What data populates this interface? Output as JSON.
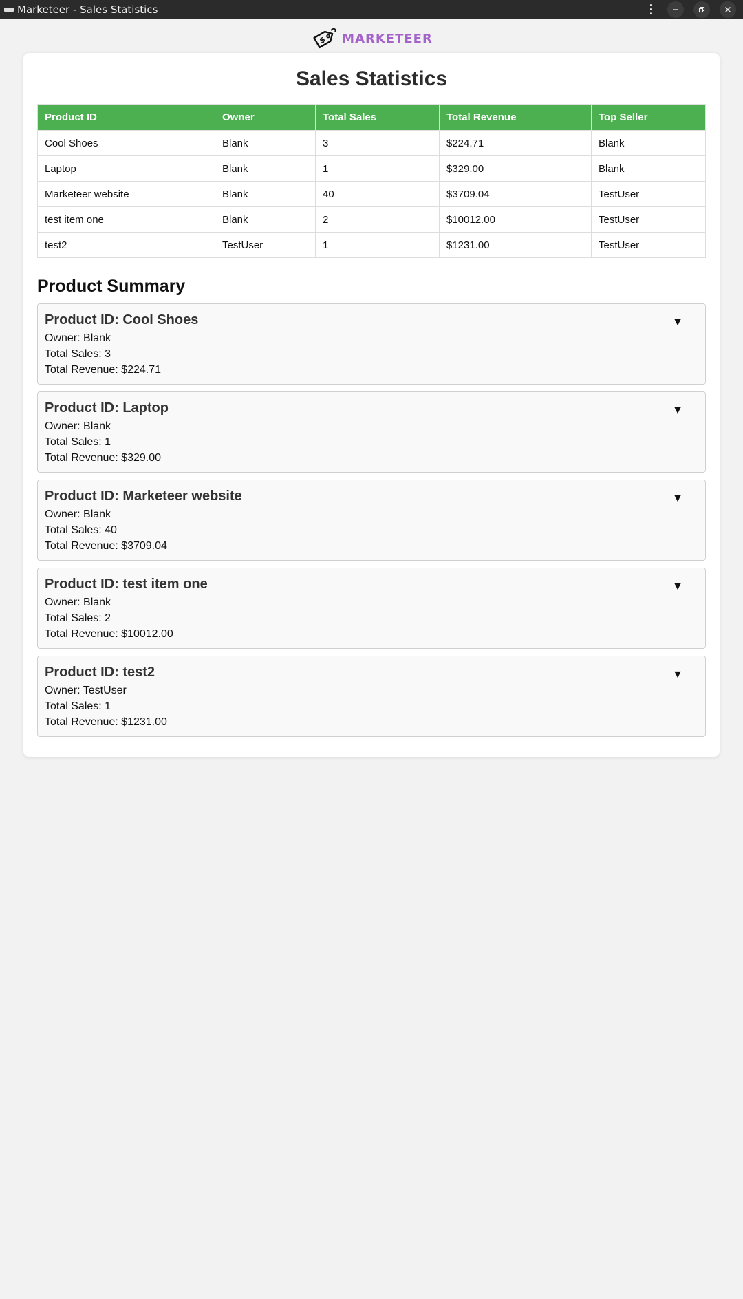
{
  "window": {
    "title": "Marketeer - Sales Statistics"
  },
  "brand": {
    "name": "MARKETEER",
    "logo_icon": "price-tag-icon",
    "accent_color": "#a463c9"
  },
  "page": {
    "title": "Sales Statistics"
  },
  "table": {
    "header_color": "#4caf50",
    "columns": [
      "Product ID",
      "Owner",
      "Total Sales",
      "Total Revenue",
      "Top Seller"
    ],
    "rows": [
      [
        "Cool Shoes",
        "Blank",
        "3",
        "$224.71",
        "Blank"
      ],
      [
        "Laptop",
        "Blank",
        "1",
        "$329.00",
        "Blank"
      ],
      [
        "Marketeer website",
        "Blank",
        "40",
        "$3709.04",
        "TestUser"
      ],
      [
        "test item one",
        "Blank",
        "2",
        "$10012.00",
        "TestUser"
      ],
      [
        "test2",
        "TestUser",
        "1",
        "$1231.00",
        "TestUser"
      ]
    ]
  },
  "summary": {
    "heading": "Product Summary",
    "toggle_icon": "triangle-down-icon",
    "toggle_glyph": "▼",
    "items": [
      {
        "title": "Product ID: Cool Shoes",
        "owner": "Owner: Blank",
        "sales": "Total Sales: 3",
        "revenue": "Total Revenue: $224.71"
      },
      {
        "title": "Product ID: Laptop",
        "owner": "Owner: Blank",
        "sales": "Total Sales: 1",
        "revenue": "Total Revenue: $329.00"
      },
      {
        "title": "Product ID: Marketeer website",
        "owner": "Owner: Blank",
        "sales": "Total Sales: 40",
        "revenue": "Total Revenue: $3709.04"
      },
      {
        "title": "Product ID: test item one",
        "owner": "Owner: Blank",
        "sales": "Total Sales: 2",
        "revenue": "Total Revenue: $10012.00"
      },
      {
        "title": "Product ID: test2",
        "owner": "Owner: TestUser",
        "sales": "Total Sales: 1",
        "revenue": "Total Revenue: $1231.00"
      }
    ]
  }
}
